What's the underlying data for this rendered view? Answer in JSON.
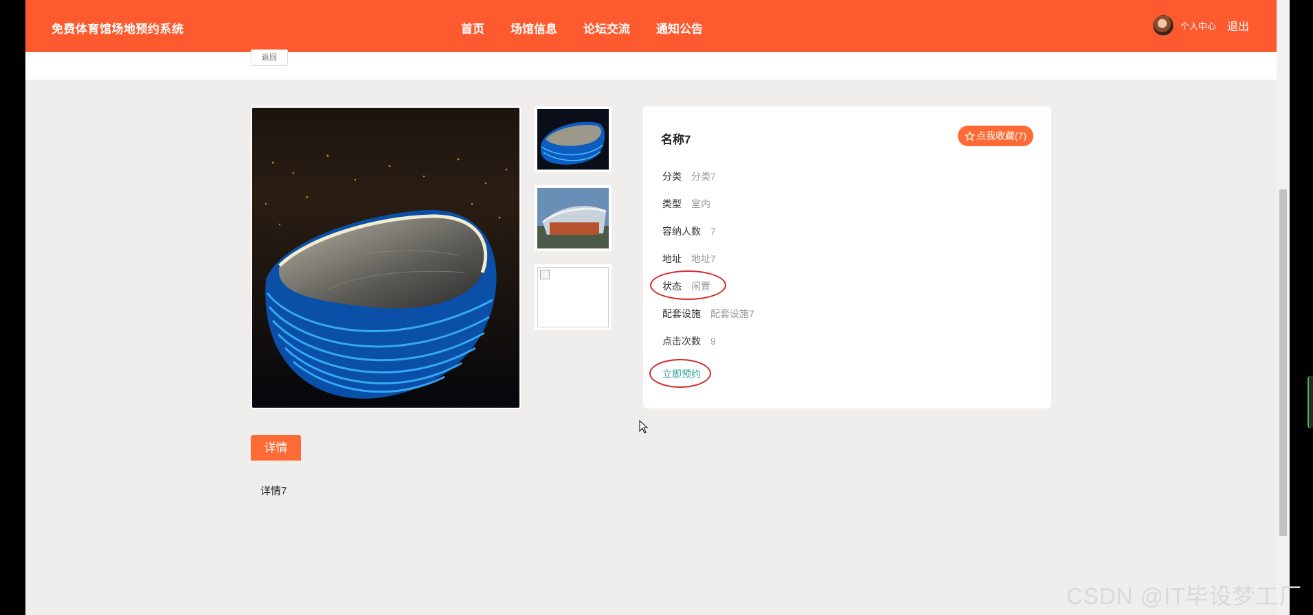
{
  "header": {
    "brand": "免费体育馆场地预约系统",
    "nav": [
      "首页",
      "场馆信息",
      "论坛交流",
      "通知公告"
    ],
    "user_center": "个人中心",
    "logout": "退出"
  },
  "back_label": "返回",
  "venue": {
    "title": "名称7",
    "favorite_label": "点我收藏(7)",
    "fields": [
      {
        "label": "分类",
        "value": "分类7"
      },
      {
        "label": "类型",
        "value": "室内"
      },
      {
        "label": "容纳人数",
        "value": "7"
      },
      {
        "label": "地址",
        "value": "地址7"
      },
      {
        "label": "状态",
        "value": "闲置"
      },
      {
        "label": "配套设施",
        "value": "配套设施7"
      },
      {
        "label": "点击次数",
        "value": "9"
      }
    ],
    "book_label": "立即预约"
  },
  "detail": {
    "tab_label": "详情",
    "text": "详情7"
  },
  "watermark": "CSDN @IT毕设梦工厂",
  "colors": {
    "header_bg": "#fe5a2f",
    "accent": "#fe6a35",
    "link": "#2a9d9a",
    "annotation": "#d62828"
  }
}
